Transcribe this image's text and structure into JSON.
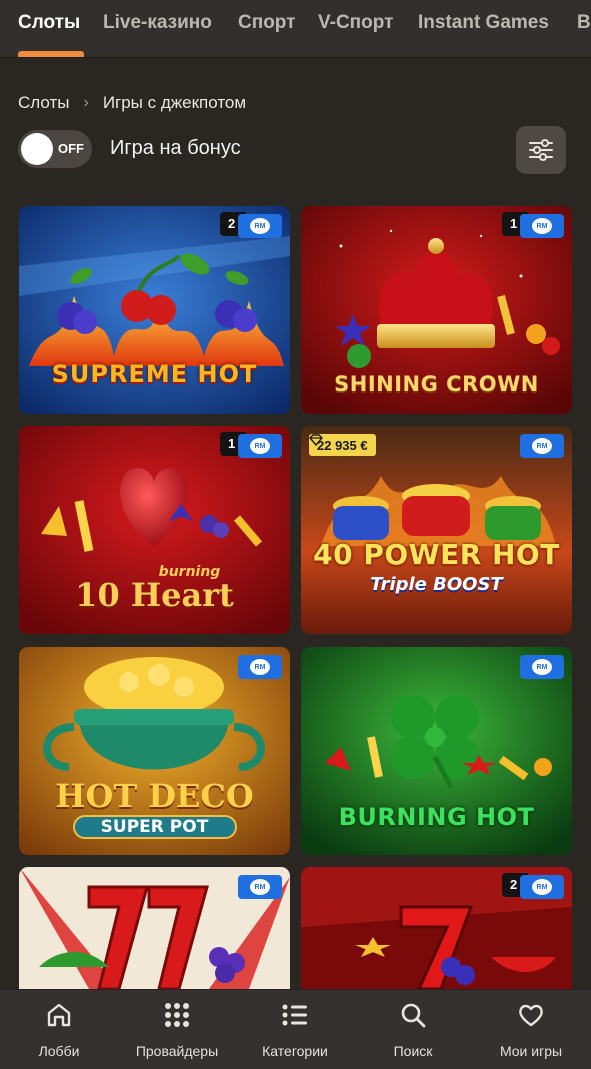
{
  "top_tabs": [
    {
      "label": "Слоты",
      "active": true
    },
    {
      "label": "Live-казино",
      "active": false
    },
    {
      "label": "Спорт",
      "active": false
    },
    {
      "label": "V-Спорт",
      "active": false
    },
    {
      "label": "Instant Games",
      "active": false
    },
    {
      "label": "В",
      "active": false
    }
  ],
  "breadcrumb": {
    "root": "Слоты",
    "current": "Игры с джекпотом"
  },
  "bonus_toggle": {
    "state": "OFF",
    "label": "Игра на бонус"
  },
  "games": [
    {
      "title": "SUPREME HOT",
      "badge": "RM",
      "count": "2"
    },
    {
      "title": "SHINING CROWN",
      "badge": "RM",
      "count": "1"
    },
    {
      "title_line1": "burning",
      "title_line2": "10 Heart",
      "badge": "RM",
      "count": "1"
    },
    {
      "title_line1": "40 POWER HOT",
      "title_line2": "Triple BOOST",
      "badge": "RM",
      "jackpot": "22 935 €"
    },
    {
      "title_line1": "HOT DECO",
      "title_line2": "SUPER POT",
      "badge": "RM"
    },
    {
      "title": "BURNING HOT",
      "badge": "RM"
    },
    {
      "title": "",
      "badge": "RM"
    },
    {
      "title": "",
      "badge": "RM",
      "count": "2"
    }
  ],
  "bottom_nav": [
    {
      "label": "Лобби",
      "icon": "home-icon"
    },
    {
      "label": "Провайдеры",
      "icon": "grid-icon"
    },
    {
      "label": "Категории",
      "icon": "list-icon"
    },
    {
      "label": "Поиск",
      "icon": "search-icon"
    },
    {
      "label": "Мои игры",
      "icon": "heart-icon"
    }
  ],
  "colors": {
    "accent": "#f08a3c",
    "background": "#2a2622",
    "rm_badge": "#1f6fe0",
    "jackpot": "#f3d44a"
  }
}
